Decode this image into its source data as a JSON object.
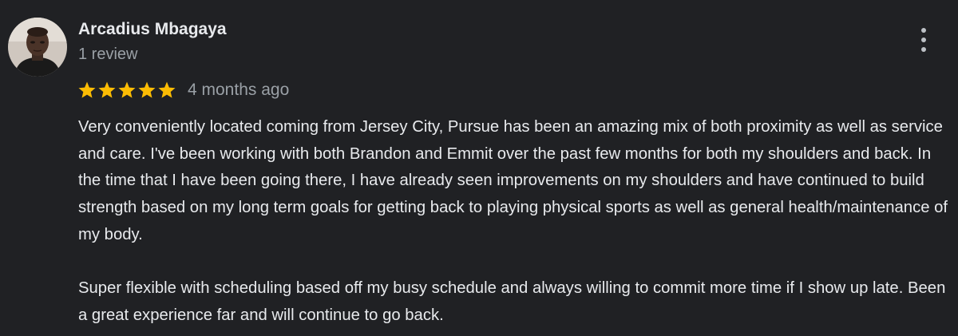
{
  "colors": {
    "background": "#202124",
    "text_primary": "#e8eaed",
    "text_secondary": "#9aa0a6",
    "star": "#fbbc04"
  },
  "review": {
    "author": {
      "name": "Arcadius Mbagaya",
      "review_count": "1 review",
      "avatar_icon": "user-avatar"
    },
    "rating": 5,
    "rating_max": 5,
    "date": "4 months ago",
    "more_icon": "more-vert-icon",
    "paragraphs": [
      "Very conveniently located coming from Jersey City, Pursue has been an amazing mix of both proximity as well as service and care. I've been working with both Brandon and Emmit over the past few months for both my shoulders and back. In the time that I have been going there, I have already seen improvements on my shoulders and have continued to build strength based on my long term goals for getting back to playing physical sports as well as general health/maintenance of my body.",
      "Super flexible with scheduling based off my busy schedule and always willing to commit more time if I show up late. Been a great experience far and will continue to go back."
    ]
  }
}
